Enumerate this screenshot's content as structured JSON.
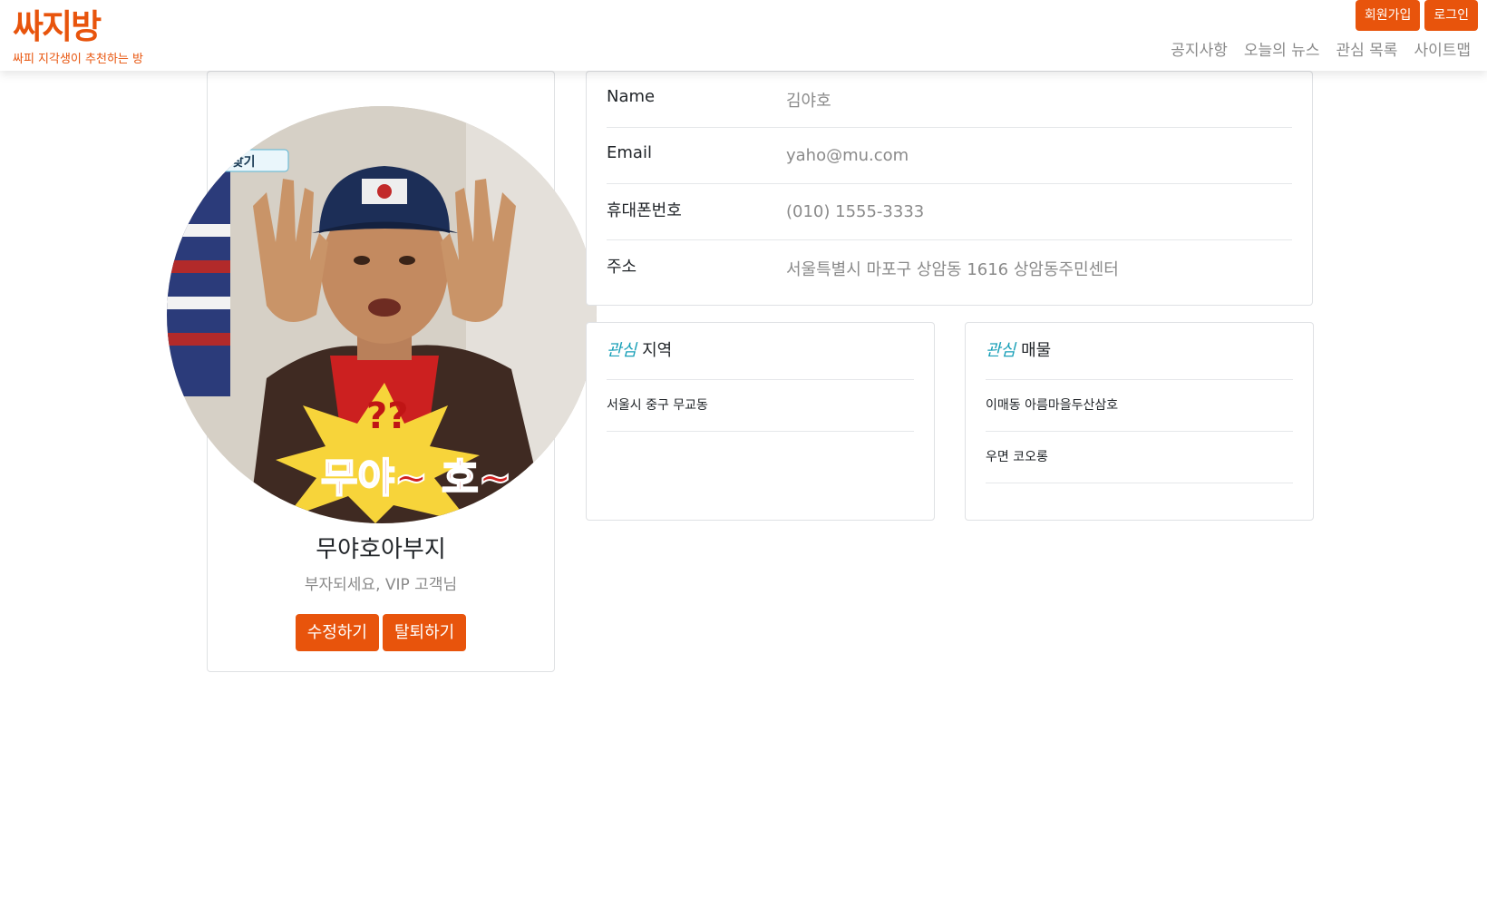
{
  "header": {
    "logo": "싸지방",
    "tagline": "싸피 지각생이 추천하는 방",
    "signup_label": "회원가입",
    "login_label": "로그인",
    "nav": [
      "공지사항",
      "오늘의 뉴스",
      "관심 목록",
      "사이트맵"
    ]
  },
  "profile": {
    "image_caption": "무야~ 호~",
    "name": "무야호아부지",
    "subtitle": "부자되세요, VIP 고객님",
    "edit_label": "수정하기",
    "withdraw_label": "탈퇴하기"
  },
  "info": {
    "rows": [
      {
        "label": "Name",
        "value": "김야호"
      },
      {
        "label": "Email",
        "value": "yaho@mu.com"
      },
      {
        "label": "휴대폰번호",
        "value": "(010) 1555-3333"
      },
      {
        "label": "주소",
        "value": "서울특별시 마포구 상암동 1616 상암동주민센터"
      }
    ]
  },
  "interest_region": {
    "accent": "관심",
    "title": "지역",
    "items": [
      "서울시 중구 무교동"
    ]
  },
  "interest_property": {
    "accent": "관심",
    "title": "매물",
    "items": [
      "이매동 아름마을두산삼호",
      "우면 코오롱"
    ]
  },
  "colors": {
    "brand": "#e8540c",
    "accent": "#1aa0b8",
    "muted_text": "#8a8a8a"
  }
}
